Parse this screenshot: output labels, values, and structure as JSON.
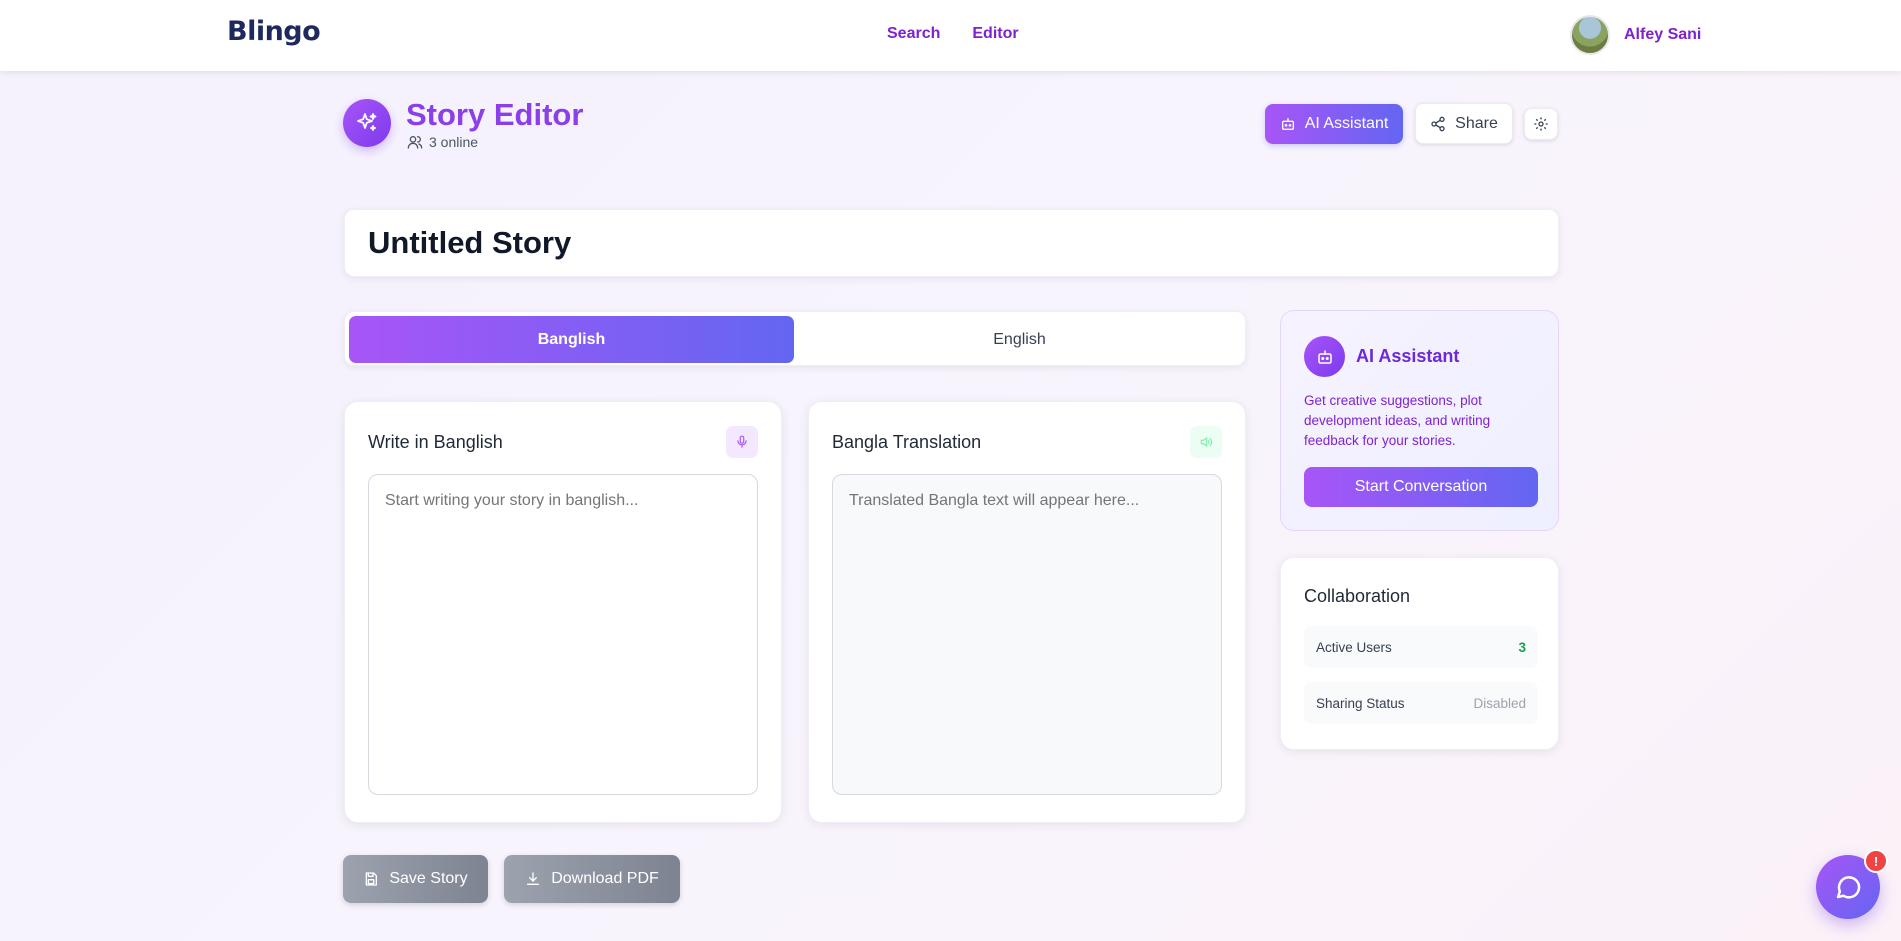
{
  "nav": {
    "logo": "Blingo",
    "links": [
      "Search",
      "Editor"
    ],
    "user_name": "Alfey Sani"
  },
  "header": {
    "title": "Story Editor",
    "online_text": "3 online",
    "ai_button": "AI Assistant",
    "share_button": "Share"
  },
  "story": {
    "title": "Untitled Story"
  },
  "tabs": {
    "active": "Banglish",
    "inactive": "English"
  },
  "editor": {
    "left_title": "Write in Banglish",
    "left_placeholder": "Start writing your story in banglish...",
    "right_title": "Bangla Translation",
    "right_placeholder": "Translated Bangla text will appear here..."
  },
  "actions": {
    "save": "Save Story",
    "download": "Download PDF"
  },
  "ai_card": {
    "title": "AI Assistant",
    "description": "Get creative suggestions, plot development ideas, and writing feedback for your stories.",
    "button": "Start Conversation"
  },
  "collaboration": {
    "title": "Collaboration",
    "rows": [
      {
        "label": "Active Users",
        "value": "3"
      },
      {
        "label": "Sharing Status",
        "value": "Disabled"
      }
    ]
  },
  "chat": {
    "badge": "!"
  },
  "colors": {
    "accent": "#a855f7",
    "accent_end": "#6366f1",
    "brand_text": "#7e22ce",
    "success": "#16a34a",
    "danger": "#ef4444"
  },
  "icons": [
    "sparkles-icon",
    "users-icon",
    "bot-icon",
    "share-icon",
    "gear-icon",
    "mic-icon",
    "speaker-icon",
    "save-icon",
    "download-icon",
    "chat-bubble-icon"
  ]
}
